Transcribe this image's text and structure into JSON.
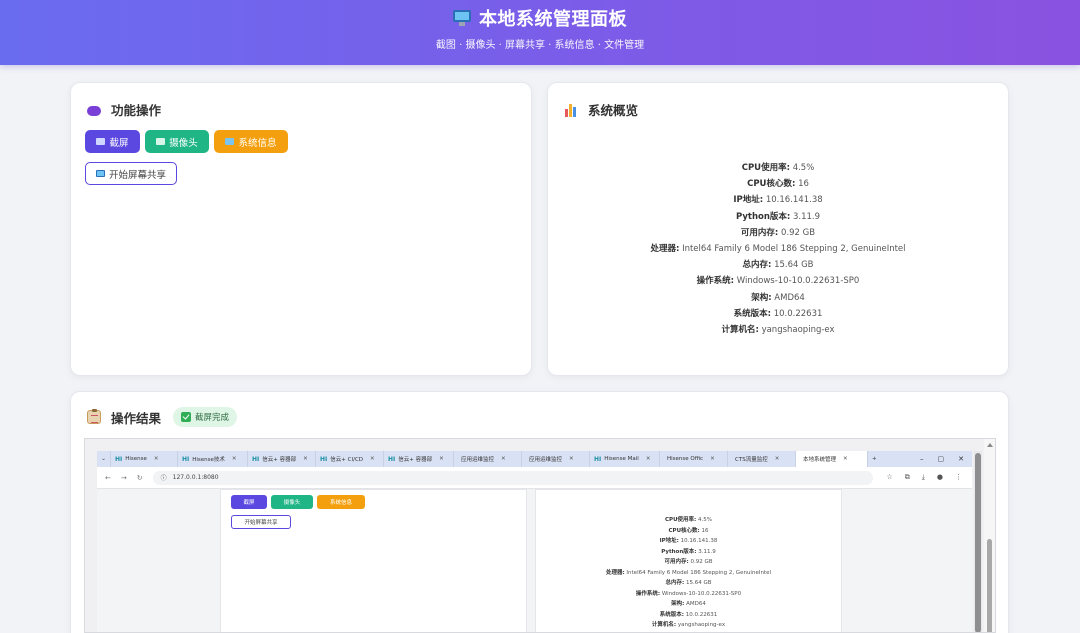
{
  "header": {
    "title": "本地系统管理面板",
    "subtitle": "截图 · 摄像头 · 屏幕共享 · 系统信息 · 文件管理"
  },
  "actions_card": {
    "title": "功能操作",
    "buttons": {
      "screenshot": "截屏",
      "camera": "摄像头",
      "sysinfo": "系统信息",
      "share": "开始屏幕共享"
    }
  },
  "overview_card": {
    "title": "系统概览",
    "rows": [
      {
        "label": "CPU使用率:",
        "value": "4.5%"
      },
      {
        "label": "CPU核心数:",
        "value": "16"
      },
      {
        "label": "IP地址:",
        "value": "10.16.141.38"
      },
      {
        "label": "Python版本:",
        "value": "3.11.9"
      },
      {
        "label": "可用内存:",
        "value": "0.92 GB"
      },
      {
        "label": "处理器:",
        "value": "Intel64 Family 6 Model 186 Stepping 2, GenuineIntel"
      },
      {
        "label": "总内存:",
        "value": "15.64 GB"
      },
      {
        "label": "操作系统:",
        "value": "Windows-10-10.0.22631-SP0"
      },
      {
        "label": "架构:",
        "value": "AMD64"
      },
      {
        "label": "系统版本:",
        "value": "10.0.22631"
      },
      {
        "label": "计算机名:",
        "value": "yangshaoping-ex"
      }
    ]
  },
  "result_card": {
    "title": "操作结果",
    "badge": "截屏完成"
  },
  "preview": {
    "tabs": [
      {
        "prefix": "HI",
        "label": "Hisense"
      },
      {
        "prefix": "HI",
        "label": "Hisense技术"
      },
      {
        "prefix": "HI",
        "label": "信云+ 容器部"
      },
      {
        "prefix": "HI",
        "label": "信云+ CI/CD"
      },
      {
        "prefix": "HI",
        "label": "信云+ 容器部"
      },
      {
        "prefix": "",
        "label": "应用运维监控"
      },
      {
        "prefix": "",
        "label": "应用运维监控"
      },
      {
        "prefix": "HI",
        "label": "Hisense Mail"
      },
      {
        "prefix": "",
        "label": "Hisense Offic"
      },
      {
        "prefix": "",
        "label": "CTS流量监控"
      },
      {
        "prefix": "",
        "label": "本地系统管理"
      }
    ],
    "url": "127.0.0.1:8080",
    "mini_buttons": {
      "screenshot": "截屏",
      "camera": "摄像头",
      "sysinfo": "系统信息",
      "share": "开始屏幕共享"
    },
    "mini_rows": [
      {
        "label": "CPU使用率:",
        "value": "4.5%"
      },
      {
        "label": "CPU核心数:",
        "value": "16"
      },
      {
        "label": "IP地址:",
        "value": "10.16.141.38"
      },
      {
        "label": "Python版本:",
        "value": "3.11.9"
      },
      {
        "label": "可用内存:",
        "value": "0.92 GB"
      },
      {
        "label": "处理器:",
        "value": "Intel64 Family 6 Model 186 Stepping 2, GenuineIntel"
      },
      {
        "label": "总内存:",
        "value": "15.64 GB"
      },
      {
        "label": "操作系统:",
        "value": "Windows-10-10.0.22631-SP0"
      },
      {
        "label": "架构:",
        "value": "AMD64"
      },
      {
        "label": "系统版本:",
        "value": "10.0.22631"
      },
      {
        "label": "计算机名:",
        "value": "yangshaoping-ex"
      }
    ]
  },
  "colors": {
    "header_gradient_start": "#6a6cf0",
    "header_gradient_end": "#8a52e0",
    "primary": "#5a48e0",
    "success": "#1fb584",
    "warning": "#f4a00e"
  }
}
